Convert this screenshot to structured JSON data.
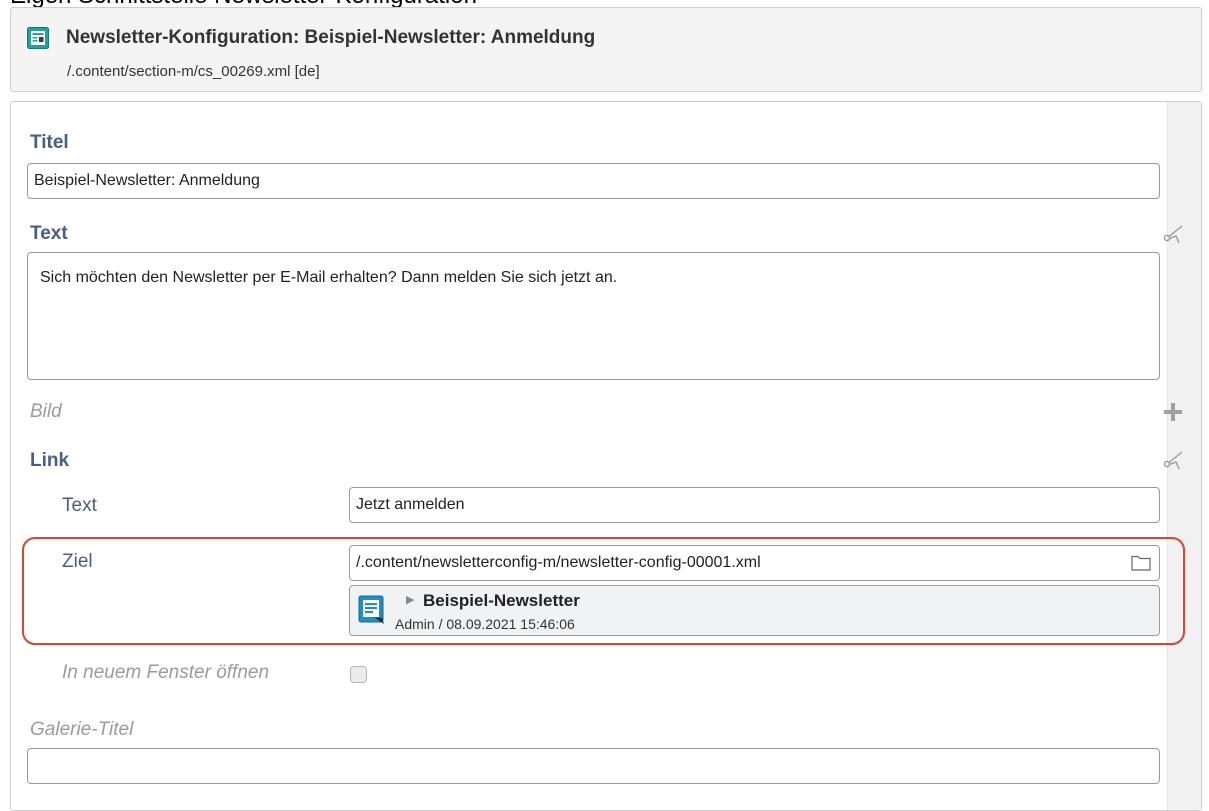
{
  "caption_partial": "Eigen Schnittstelle Newsletter-Konfiguration",
  "header": {
    "icon": "newsletter-config-icon",
    "title": "Newsletter-Konfiguration: Beispiel-Newsletter: Anmeldung",
    "path": "/.content/section-m/cs_00269.xml [de]"
  },
  "form": {
    "titel": {
      "label": "Titel",
      "value": "Beispiel-Newsletter: Anmeldung"
    },
    "text": {
      "label": "Text",
      "value": "Sich möchten den Newsletter per E-Mail erhalten? Dann melden Sie sich jetzt an.",
      "action_icon": "scissors-icon"
    },
    "bild": {
      "label": "Bild",
      "action_icon": "plus-icon"
    },
    "link": {
      "label": "Link",
      "action_icon": "scissors-icon",
      "text": {
        "label": "Text",
        "value": "Jetzt anmelden"
      },
      "ziel": {
        "label": "Ziel",
        "value": "/.content/newsletterconfig-m/newsletter-config-00001.xml",
        "browse_icon": "folder-icon",
        "ref_title": "Beispiel-Newsletter",
        "ref_meta": "Admin / 08.09.2021 15:46:06",
        "ref_icon": "newsletter-resource-icon",
        "highlight_color": "#e1412f"
      },
      "new_window": {
        "label": "In neuem Fenster öffnen",
        "checked": false
      }
    },
    "galerie_titel": {
      "label": "Galerie-Titel",
      "value": ""
    }
  },
  "colors": {
    "label": "#4a5d85",
    "optional_label": "#9b9b9b",
    "accent_icon": "#1d8fc8"
  }
}
